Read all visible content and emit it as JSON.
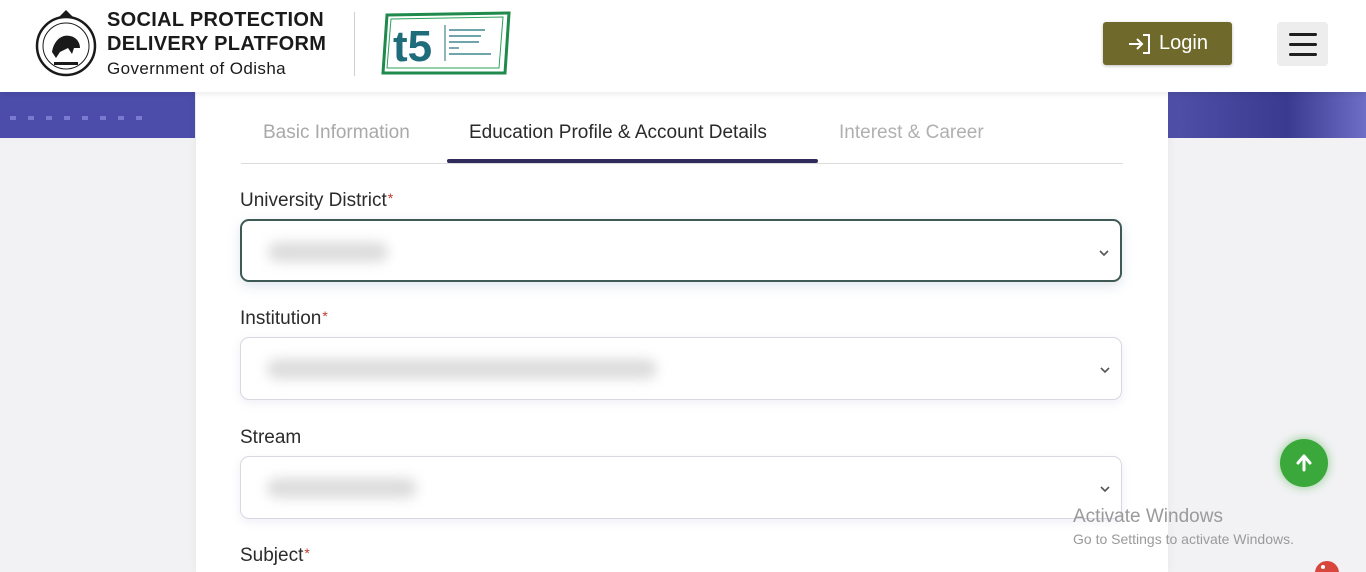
{
  "header": {
    "org_line1": "SOCIAL PROTECTION",
    "org_line2": "DELIVERY PLATFORM",
    "org_line3": "Government of Odisha",
    "login_label": "Login",
    "t5_text": "t5"
  },
  "tabs": [
    {
      "label": "Basic Information",
      "state": "inactive"
    },
    {
      "label": "Education Profile & Account Details",
      "state": "active"
    },
    {
      "label": "Interest & Career",
      "state": "disabled"
    }
  ],
  "form": {
    "university_district": {
      "label": "University District",
      "required_mark": "*",
      "value": ""
    },
    "institution": {
      "label": "Institution",
      "required_mark": "*",
      "value": ""
    },
    "stream": {
      "label": "Stream",
      "required_mark": "",
      "value": ""
    },
    "subject": {
      "label": "Subject",
      "required_mark": "*",
      "value": ""
    }
  },
  "watermark": {
    "title": "Activate Windows",
    "subtitle": "Go to Settings to activate Windows."
  },
  "colors": {
    "login_bg": "#6f6a2c",
    "tab_underline": "#2f2c5c",
    "scroll_top_bg": "#3aa83a",
    "required": "#c0392b",
    "band": "#4c4cab"
  },
  "icons": {
    "login": "login-arrow-icon",
    "menu": "hamburger-icon",
    "select": "chevron-down-icon",
    "scroll_top": "arrow-up-icon"
  }
}
